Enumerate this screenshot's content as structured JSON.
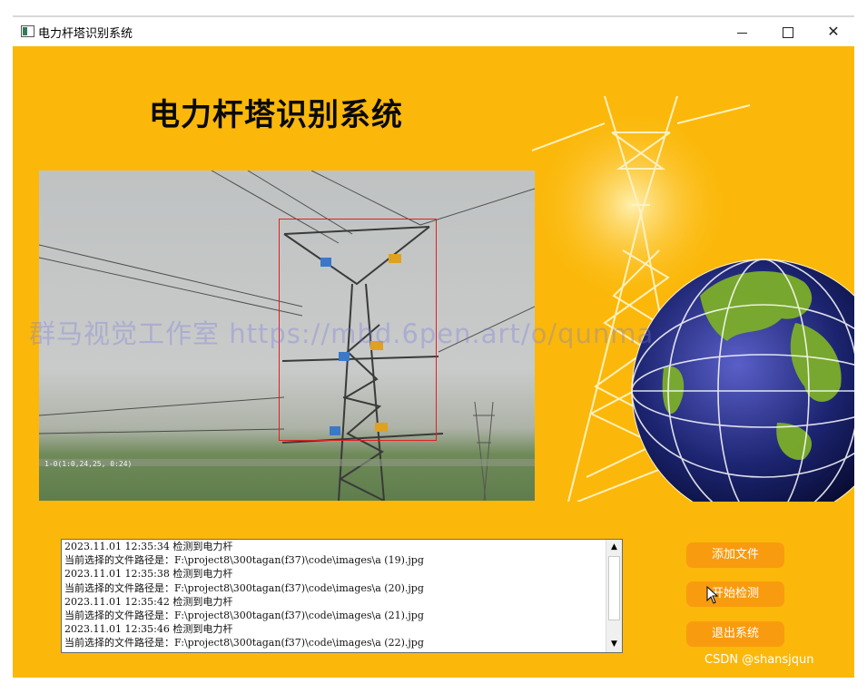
{
  "window": {
    "title": "电力杆塔识别系统",
    "controls": {
      "minimize": "minimize-icon",
      "maximize": "maximize-icon",
      "close": "close-icon"
    }
  },
  "header": {
    "title": "电力杆塔识别系统"
  },
  "photo": {
    "timestamp": "1-0(1:0,24,25, 0:24)"
  },
  "watermark": {
    "text": "群马视觉工作室 https://mbd.6pen.art/o/qunma"
  },
  "log": {
    "lines": [
      "2023.11.01 12:35:34  检测到电力杆",
      "当前选择的文件路径是：F:\\project8\\300tagan(f37)\\code\\images\\a (19).jpg",
      "2023.11.01 12:35:38  检测到电力杆",
      "当前选择的文件路径是：F:\\project8\\300tagan(f37)\\code\\images\\a (20).jpg",
      "2023.11.01 12:35:42  检测到电力杆",
      "当前选择的文件路径是：F:\\project8\\300tagan(f37)\\code\\images\\a (21).jpg",
      "2023.11.01 12:35:46  检测到电力杆",
      "当前选择的文件路径是：F:\\project8\\300tagan(f37)\\code\\images\\a (22).jpg"
    ]
  },
  "buttons": {
    "add_file": "添加文件",
    "start_detect": "开始检测",
    "exit_system": "退出系统"
  },
  "footer": {
    "credit": "CSDN @shansjqun"
  },
  "colors": {
    "background": "#fbb80a",
    "button": "#f99b0f",
    "detection_box": "#e02020"
  }
}
